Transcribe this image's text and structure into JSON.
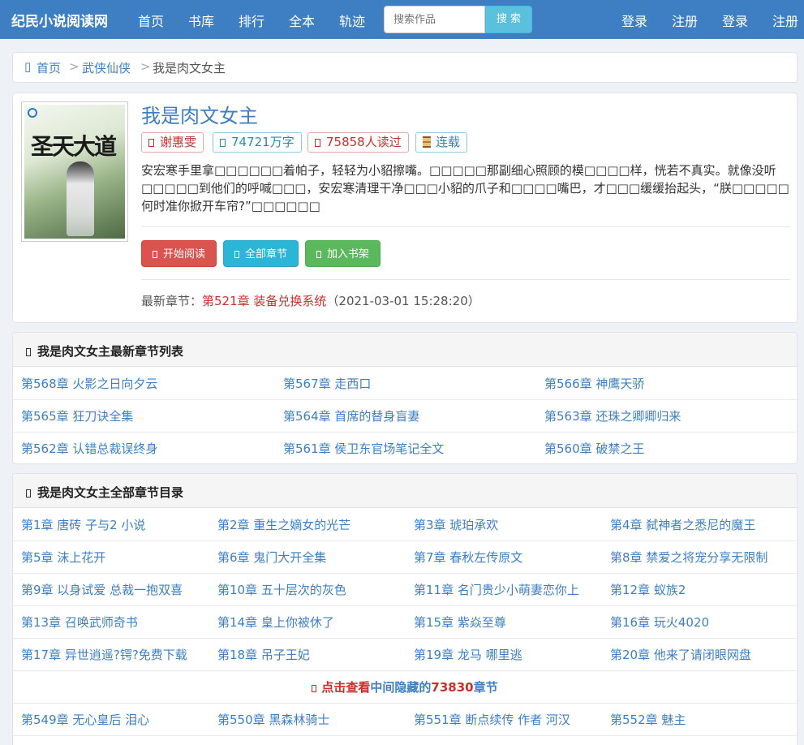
{
  "nav": {
    "brand": "纪民小说阅读网",
    "links": [
      "首页",
      "书库",
      "排行",
      "全本",
      "轨迹"
    ],
    "search_placeholder": "搜索作品",
    "search_button": "搜 索",
    "auth": [
      "登录",
      "注册",
      "登录",
      "注册"
    ]
  },
  "breadcrumb": {
    "home": "首页",
    "sep": ">",
    "category": "武侠仙侠",
    "current": "我是肉文女主"
  },
  "book": {
    "cover_text": "圣天大道",
    "title": "我是肉文女主",
    "author": "谢惠雯",
    "words": "74721万字",
    "readers": "75858人读过",
    "status": "连载",
    "description": "安宏寒手里拿□□□□□□着帕子，轻轻为小貂擦嘴。□□□□□那副细心照顾的模□□□□样，恍若不真实。就像没听□□□□□到他们的呼喊□□□，安宏寒清理干净□□□小貂的爪子和□□□□嘴巴，才□□□缓缓抬起头，“朕□□□□□何时准你掀开车帘?”□□□□□□",
    "btn_read": "开始阅读",
    "btn_all": "全部章节",
    "btn_shelf": "加入书架",
    "latest_label": "最新章节：",
    "latest_chapter": "第521章 装备兑换系统",
    "latest_time": "（2021-03-01 15:28:20）"
  },
  "latest_section": {
    "title": "我是肉文女主最新章节列表",
    "chapters": [
      "第568章 火影之日向夕云",
      "第567章 走西口",
      "第566章 神鹰天骄",
      "第565章 狂刀诀全集",
      "第564章 首席的替身盲妻",
      "第563章 还珠之卿卿归来",
      "第562章 认错总裁误终身",
      "第561章 侯卫东官场笔记全文",
      "第560章 破禁之王"
    ]
  },
  "all_section": {
    "title": "我是肉文女主全部章节目录",
    "chapters_top": [
      "第1章 唐砖 子与2 小说",
      "第2章 重生之嫡女的光芒",
      "第3章 琥珀承欢",
      "第4章 弑神者之悉尼的魔王",
      "第5章 沫上花开",
      "第6章 鬼门大开全集",
      "第7章 春秋左传原文",
      "第8章 禁爱之将宠分享无限制",
      "第9章 以身试爱 总裁一抱双喜",
      "第10章 五十层次的灰色",
      "第11章 名门贵少小萌妻恋你上",
      "第12章 蚁族2",
      "第13章 召唤武师奇书",
      "第14章 皇上你被休了",
      "第15章 紫焱至尊",
      "第16章 玩火4020",
      "第17章 异世逍遥?锷?免费下载",
      "第18章 吊子王妃",
      "第19章 龙马 哪里逃",
      "第20章 他来了请闭眼网盘"
    ],
    "hidden_prefix": "点击查看",
    "hidden_middle": "中间隐藏的",
    "hidden_count": "73830",
    "hidden_suffix": "章节",
    "chapters_bottom": [
      "第549章 无心皇后 泪心",
      "第550章 黑森林骑士",
      "第551章 断点续传 作者 河汉",
      "第552章 魅主"
    ]
  }
}
